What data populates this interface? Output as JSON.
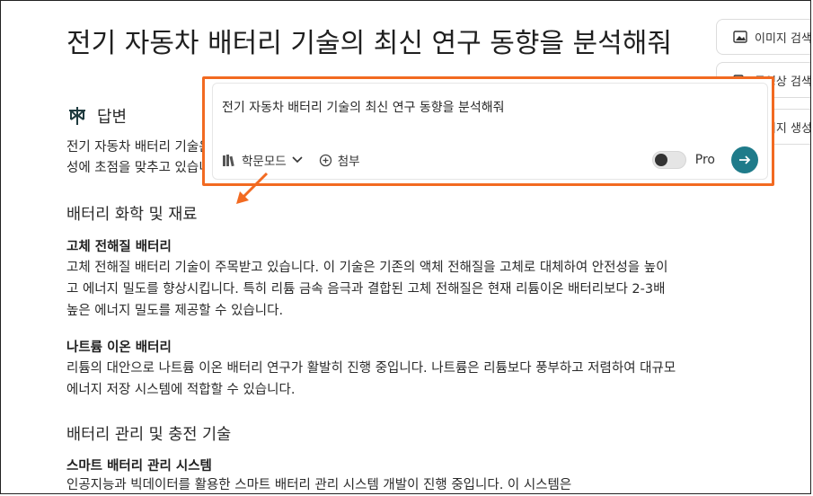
{
  "page": {
    "title": "전기 자동차 배터리 기술의 최신 연구 동향을 분석해줘",
    "answer_label": "답변",
    "intro": "전기 자동차 배터리 기술은 최근 몇 년간 급속도로 발전하고 있으며, 에너지 밀도, 충전 속도, 안전성 및 지속 가능성에 초점을 맞추고 있습니다."
  },
  "sections": [
    {
      "heading": "배터리 화학 및 재료",
      "items": [
        {
          "subheading": "고체 전해질 배터리",
          "text": "고체 전해질 배터리 기술이 주목받고 있습니다. 이 기술은 기존의 액체 전해질을 고체로 대체하여 안전성을 높이고 에너지 밀도를 향상시킵니다. 특히 리튬 금속 음극과 결합된 고체 전해질은 현재 리튬이온 배터리보다 2-3배 높은 에너지 밀도를 제공할 수 있습니다."
        },
        {
          "subheading": "나트륨 이온 배터리",
          "text": "리튬의 대안으로 나트륨 이온 배터리 연구가 활발히 진행 중입니다. 나트륨은 리튬보다 풍부하고 저렴하여 대규모 에너지 저장 시스템에 적합할 수 있습니다."
        }
      ]
    },
    {
      "heading": "배터리 관리 및 충전 기술",
      "items": [
        {
          "subheading": "스마트 배터리 관리 시스템",
          "text": "인공지능과 빅데이터를 활용한 스마트 배터리 관리 시스템 개발이 진행 중입니다. 이 시스템은"
        }
      ]
    }
  ],
  "sidebar": {
    "image_search": "이미지 검색",
    "video_search": "동영상 검색",
    "image_generate": "이미지 생성"
  },
  "input": {
    "query": "전기 자동차 배터리 기술의 최신 연구 동향을 분석해줘",
    "mode_label": "학문모드",
    "attach_label": "첨부",
    "pro_label": "Pro"
  },
  "colors": {
    "highlight": "#f26a21",
    "send_button": "#1f7b8a"
  }
}
